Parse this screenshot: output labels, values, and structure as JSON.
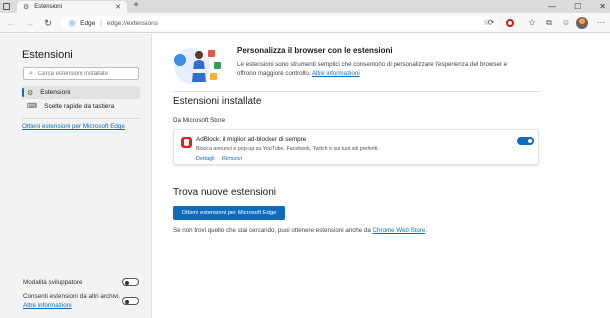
{
  "browser": {
    "tab_title": "Estensioni",
    "tab_close": "✕",
    "new_tab": "+",
    "window_controls": [
      "—",
      "☐",
      "✕"
    ],
    "site_label": "Edge",
    "separator": "|",
    "url": "edge://extensions"
  },
  "sidebar": {
    "title": "Estensioni",
    "search_placeholder": "Cerca estensioni installate",
    "items": [
      {
        "label": "Estensioni",
        "icon": "extensions-icon",
        "selected": true
      },
      {
        "label": "Scelte rapide da tastiera",
        "icon": "keyboard-icon",
        "selected": false
      }
    ],
    "store_link": "Ottieni estensioni per Microsoft Edge",
    "developer_mode_label": "Modalità sviluppatore",
    "developer_mode_on": false,
    "other_stores_label": "Consenti estensioni da altri archivi.",
    "other_stores_on": false,
    "more_info": "Altre informazioni"
  },
  "main": {
    "hero": {
      "title": "Personalizza il browser con le estensioni",
      "description": "Le estensioni sono strumenti semplici che consentono di personalizzare l'esperienza del browser e offrono maggiore controllo.",
      "link": "Altre informazioni"
    },
    "installed_title": "Estensioni installate",
    "store_label": "Da Microsoft Store",
    "extension": {
      "name": "AdBlock: il miglior ad-blocker di sempre",
      "description": "Blocca annunci e pop-up su YouTube, Facebook, Twitch e sui tuoi siti preferiti.",
      "details": "Dettagli",
      "remove": "Rimuovi",
      "enabled": true
    },
    "find_title": "Trova nuove estensioni",
    "get_button": "Ottieni estensioni per Microsoft Edge",
    "find_text": "Se non trovi quello che stai cercando, puoi ottenere estensioni anche da",
    "chrome_link": "Chrome Web Store",
    "find_end": "."
  },
  "colors": {
    "accent": "#0f6cbd",
    "sidebar_bg": "#f3f3f3",
    "adblock_red": "#e01e1e"
  }
}
